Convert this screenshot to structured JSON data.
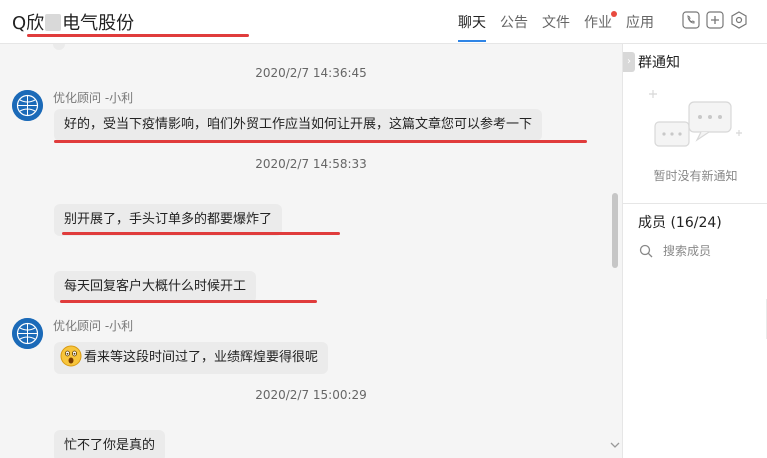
{
  "header": {
    "title_prefix": "Q欣",
    "title_suffix": "电气股份",
    "tabs": [
      {
        "label": "聊天"
      },
      {
        "label": "公告"
      },
      {
        "label": "文件"
      },
      {
        "label": "作业"
      },
      {
        "label": "应用"
      }
    ],
    "icons": [
      "phone-icon",
      "add-icon",
      "settings-hex-icon"
    ]
  },
  "chat": {
    "messages": [
      {
        "time": "2020/2/7 14:36:45",
        "sender": "优化顾问 -小利",
        "text": "好的，受当下疫情影响，咱们外贸工作应当如何让开展，这篇文章您可以参考一下"
      },
      {
        "time": "2020/2/7 14:58:33",
        "text": "别开展了，手头订单多的都要爆炸了"
      },
      {
        "text": "每天回复客户大概什么时候开工"
      },
      {
        "sender": "优化顾问 -小利",
        "text": "看来等这段时间过了，业绩辉煌要得很呢"
      },
      {
        "time": "2020/2/7 15:00:29",
        "text": "忙不了你是真的"
      }
    ]
  },
  "sidebar": {
    "notice_title": "群通知",
    "notice_empty": "暂时没有新通知",
    "members_label": "成员 (16/24)",
    "search_placeholder": "搜索成员"
  },
  "colors": {
    "accent": "#2f85e6",
    "annotation": "#e03c3c",
    "badge": "#e84a3f"
  }
}
